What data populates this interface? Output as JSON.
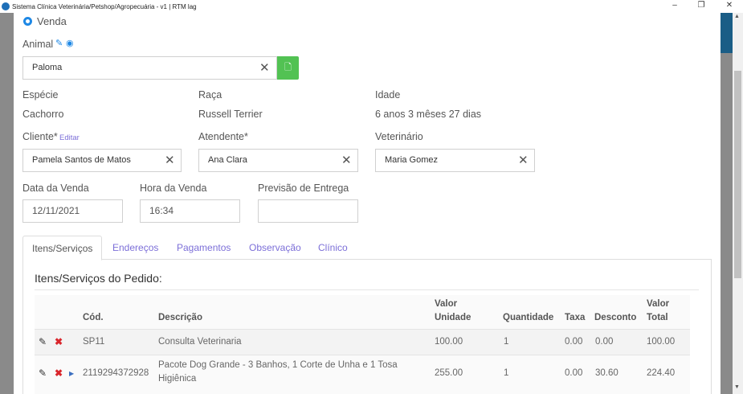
{
  "window": {
    "title": "Sistema Clínica Veterinária/Petshop/Agropecuária - v1 | RTM lag",
    "minimize": "–",
    "restore": "❐",
    "close": "✕"
  },
  "form": {
    "sale_type_label": "Venda",
    "animal": {
      "label": "Animal",
      "value": "Paloma",
      "clear": "✕",
      "edit_icon": "edit-icon",
      "view_icon": "eye-icon",
      "file_icon": "file-icon"
    },
    "species": {
      "label": "Espécie",
      "value": "Cachorro"
    },
    "breed": {
      "label": "Raça",
      "value": "Russell Terrier"
    },
    "age": {
      "label": "Idade",
      "value": "6 anos 3 mêses 27 dias"
    },
    "client": {
      "label": "Cliente*",
      "edit_link": "Editar",
      "value": "Pamela Santos de Matos",
      "clear": "✕"
    },
    "attendant": {
      "label": "Atendente*",
      "value": "Ana Clara",
      "clear": "✕"
    },
    "vet": {
      "label": "Veterinário",
      "value": "Maria Gomez",
      "clear": "✕"
    },
    "sale_date": {
      "label": "Data da Venda",
      "value": "12/11/2021"
    },
    "sale_time": {
      "label": "Hora da Venda",
      "value": "16:34"
    },
    "delivery": {
      "label": "Previsão de Entrega",
      "value": ""
    }
  },
  "tabs": [
    {
      "label": "Itens/Serviços",
      "active": true
    },
    {
      "label": "Endereços"
    },
    {
      "label": "Pagamentos"
    },
    {
      "label": "Observação"
    },
    {
      "label": "Clínico"
    }
  ],
  "items": {
    "title": "Itens/Serviços do Pedido:",
    "headers": {
      "code": "Cód.",
      "description": "Descrição",
      "unit_value_1": "Valor",
      "unit_value_2": "Unidade",
      "quantity": "Quantidade",
      "tax": "Taxa",
      "discount": "Desconto",
      "total_1": "Valor",
      "total_2": "Total"
    },
    "rows": [
      {
        "code": "SP11",
        "description": "Consulta Veterinaria",
        "description_2": "",
        "unit": "100.00",
        "qty": "1",
        "tax": "0.00",
        "discount": "0.00",
        "total": "100.00"
      },
      {
        "code": "2119294372928",
        "description": "Pacote Dog Grande - 3 Banhos, 1 Corte de Unha e 1 Tosa",
        "description_2": "Higiênica",
        "unit": "255.00",
        "qty": "1",
        "tax": "0.00",
        "discount": "30.60",
        "total": "224.40"
      }
    ],
    "edit_icon": "✎",
    "delete_icon": "✖",
    "expand_icon": "▶"
  },
  "colors": {
    "accent": "#1e88e5",
    "tab_link": "#7c6fd8",
    "green": "#52c253",
    "danger": "#d9262c"
  }
}
